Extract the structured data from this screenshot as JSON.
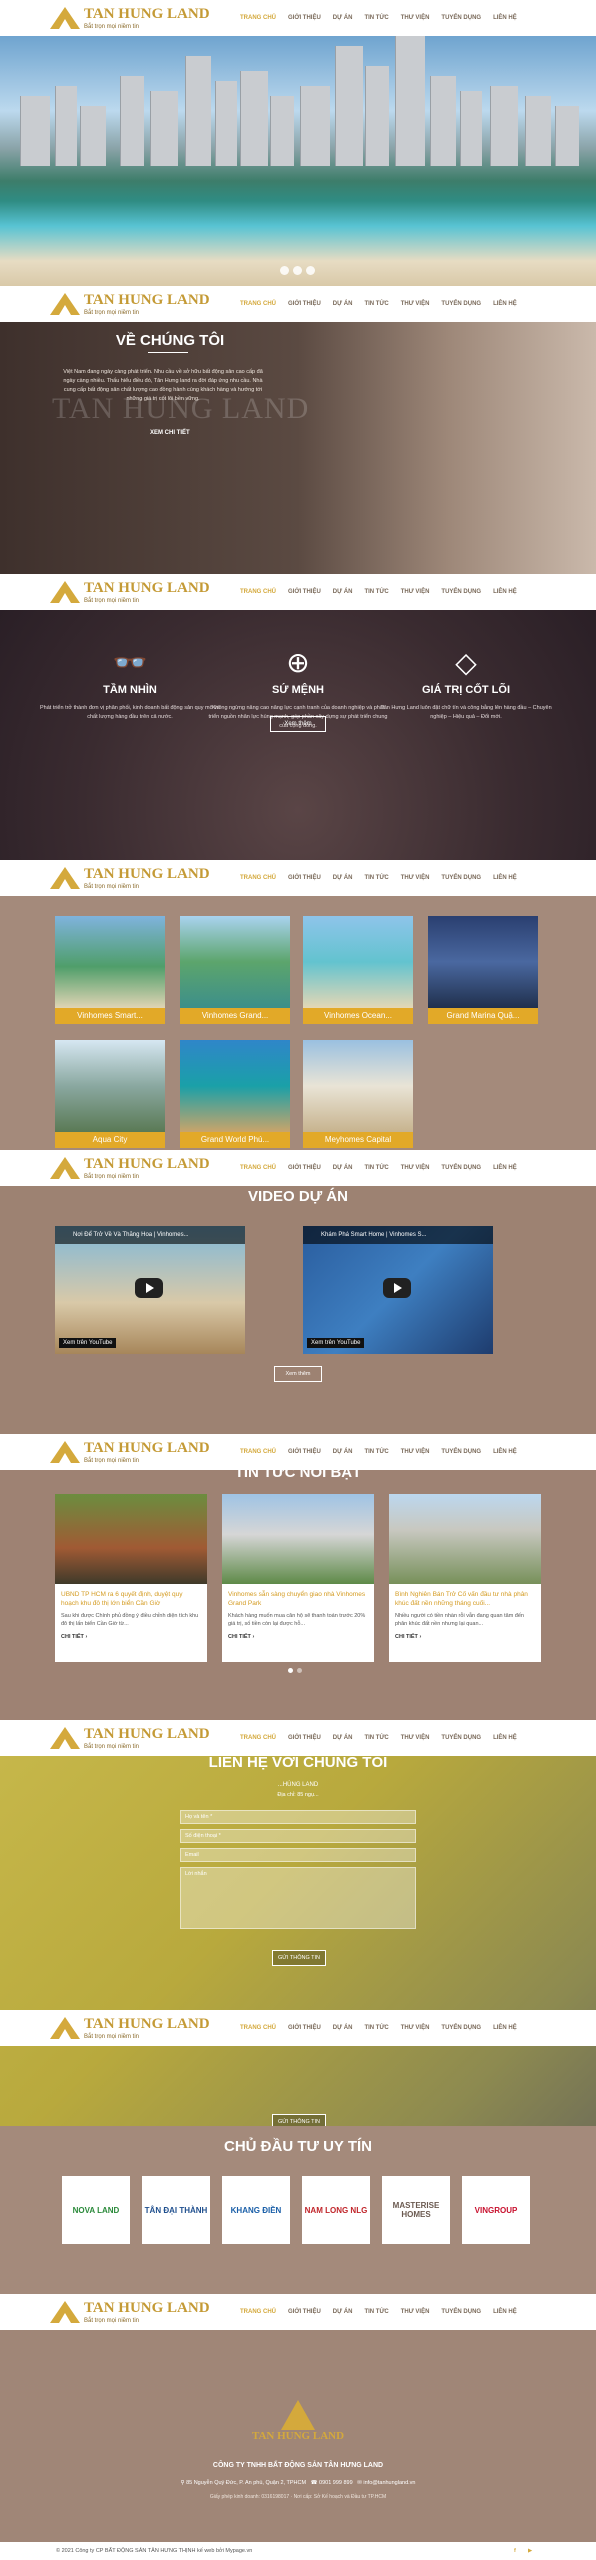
{
  "brand": {
    "name": "TAN HUNG LAND",
    "tagline": "Bắt trọn mọi niềm tin"
  },
  "nav": [
    "TRANG CHỦ",
    "GIỚI THIỆU",
    "DỰ ÁN",
    "TIN TỨC",
    "THƯ VIỆN",
    "TUYỂN DỤNG",
    "LIÊN HỆ"
  ],
  "about": {
    "title": "VỀ CHÚNG TÔI",
    "text": "Việt Nam đang ngày càng phát triển. Nhu cầu về sở hữu bất động sản cao cấp đã ngày càng nhiều. Thấu hiểu điều đó, Tân Hưng land ra đời đáp ứng nhu cầu. Nhà cung cấp bất động sản chất lượng cao đồng hành cùng khách hàng và hướng tới những giá trị cốt lõi bền vững.",
    "link": "XEM CHI TIẾT",
    "watermark": "TAN HUNG LAND"
  },
  "values": [
    {
      "icon": "binoculars-icon",
      "glyph": "👓",
      "title": "TẦM NHÌN",
      "text": "Phát triển trở thành đơn vị phân phối, kinh doanh bất động sản quy mô và chất lượng hàng đầu trên cả nước."
    },
    {
      "icon": "target-icon",
      "glyph": "⊕",
      "title": "SỨ MỆNH",
      "text": "Không ngừng nâng cao năng lực cạnh tranh của doanh nghiệp và phát triển nguồn nhân lực hùng mạnh, góp phần xây dựng sự phát triển chung của cộng đồng."
    },
    {
      "icon": "diamond-icon",
      "glyph": "◇",
      "title": "GIÁ TRỊ CỐT LÕI",
      "text": "Tân Hưng Land luôn đặt chữ tín và công bằng lên hàng đầu – Chuyên nghiệp – Hiệu quả – Đổi mới."
    }
  ],
  "values_more": "Xem thêm",
  "projects": [
    "Vinhomes Smart...",
    "Vinhomes Grand...",
    "Vinhomes Ocean...",
    "Grand Marina Quậ...",
    "Aqua City",
    "Grand World Phú...",
    "Meyhomes Capital"
  ],
  "video": {
    "title": "VIDEO DỰ ÁN",
    "items": [
      "Nơi Để Trở Về Và Thăng Hoa | Vinhomes...",
      "Khám Phá Smart Home | Vinhomes S..."
    ],
    "watch": "Xem trên",
    "youtube": "YouTube",
    "more": "Xem thêm"
  },
  "news": {
    "title": "TIN TỨC NỔI BẬT",
    "items": [
      {
        "title": "UBND TP HCM ra 6 quyết định, duyệt quy hoạch khu đô thị lớn biển Cần Giờ",
        "desc": "Sau khi được Chính phủ đồng ý điều chỉnh diện tích khu đô thị lấn biển Cần Giờ từ...",
        "more": "CHI TIẾT ›"
      },
      {
        "title": "Vinhomes sẵn sàng chuyển giao nhà Vinhomes Grand Park",
        "desc": "Khách hàng muốn mua căn hộ sẽ thanh toán trước 20% giá trị, số tiền còn lại được hỗ...",
        "more": "CHI TIẾT ›"
      },
      {
        "title": "Bình Nghiên Bán Trở Cố vấn đầu tư nhà phân khúc đất nền những tháng cuối...",
        "desc": "Nhiều người có tiền nhàn rỗi vẫn đang quan tâm đến phân khúc đất nền nhưng lại quan...",
        "more": "CHI TIẾT ›"
      }
    ]
  },
  "contact": {
    "title": "LIÊN HỆ VỚI CHÚNG TÔI",
    "company": "...HÙNG LAND",
    "subtitle": "Địa chỉ: 85 ngụ...",
    "fields": [
      "Họ và tên *",
      "Số điện thoại *",
      "Email",
      "Lời nhắn"
    ],
    "submit": "GỬI THÔNG TIN"
  },
  "investors": {
    "title": "CHỦ ĐẦU TƯ UY TÍN",
    "logos": [
      "NOVA LAND",
      "TÂN ĐẠI THÀNH",
      "KHANG ĐIỀN",
      "NAM LONG NLG",
      "MASTERISE HOMES",
      "VINGROUP"
    ]
  },
  "footer": {
    "company": "CÔNG TY TNHH BẤT ĐỘNG SẢN TÂN HƯNG LAND",
    "address": "85 Nguyễn Quý Đức, P. An phú, Quận 2, TPHCM",
    "phone": "0901 999 899",
    "email": "info@tanhungland.vn",
    "license": "Giấy phép kinh doanh: 0316198017 · Nơi cấp: Sở Kế hoạch và Đầu tư TP.HCM",
    "copyright": "© 2021 Công ty CP BẤT ĐỘNG SẢN TÂN HƯNG THỊNH kế web bởi Mypage.vn"
  },
  "colors": {
    "accent": "#d4a93c",
    "label_bg": "#e2a928",
    "section_bg": "#a48a7b"
  }
}
